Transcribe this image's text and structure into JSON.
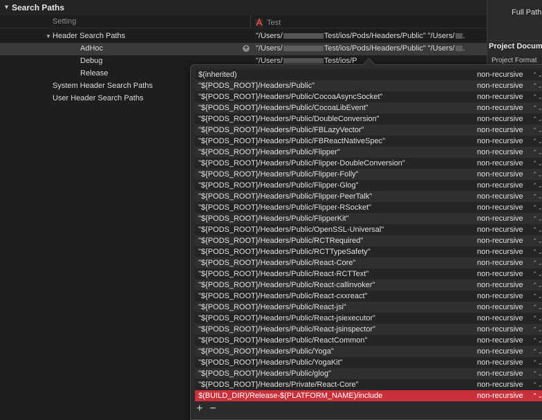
{
  "section": {
    "title": "Search Paths",
    "disclosure": "▼"
  },
  "columns": {
    "setting": "Setting",
    "target": "Test",
    "target_icon": "xcode-app-icon"
  },
  "rows": [
    {
      "label": "Header Search Paths",
      "value_pre": "\"/Users/",
      "value_post": "Test/ios/Pods/Headers/Public\" \"/Users/",
      "value_end": "."
    },
    {
      "label": "AdHoc",
      "value_pre": "\"/Users/",
      "value_post": "Test/ios/Pods/Headers/Public\" \"/Users/",
      "value_end": "."
    },
    {
      "label": "Debug",
      "value_pre": "\"/Users/",
      "value_post": "Test/ios/P",
      "value_end": ""
    },
    {
      "label": "Release"
    },
    {
      "label": "System Header Search Paths"
    },
    {
      "label": "User Header Search Paths"
    }
  ],
  "inspector": {
    "full_path": "Full Path",
    "project_document": "Project Docume",
    "project_format": "Project Format"
  },
  "popover": {
    "items": [
      {
        "path": "$(inherited)",
        "recursion": "non-recursive"
      },
      {
        "path": "\"${PODS_ROOT}/Headers/Public\"",
        "recursion": "non-recursive"
      },
      {
        "path": "\"${PODS_ROOT}/Headers/Public/CocoaAsyncSocket\"",
        "recursion": "non-recursive"
      },
      {
        "path": "\"${PODS_ROOT}/Headers/Public/CocoaLibEvent\"",
        "recursion": "non-recursive"
      },
      {
        "path": "\"${PODS_ROOT}/Headers/Public/DoubleConversion\"",
        "recursion": "non-recursive"
      },
      {
        "path": "\"${PODS_ROOT}/Headers/Public/FBLazyVector\"",
        "recursion": "non-recursive"
      },
      {
        "path": "\"${PODS_ROOT}/Headers/Public/FBReactNativeSpec\"",
        "recursion": "non-recursive"
      },
      {
        "path": "\"${PODS_ROOT}/Headers/Public/Flipper\"",
        "recursion": "non-recursive"
      },
      {
        "path": "\"${PODS_ROOT}/Headers/Public/Flipper-DoubleConversion\"",
        "recursion": "non-recursive"
      },
      {
        "path": "\"${PODS_ROOT}/Headers/Public/Flipper-Folly\"",
        "recursion": "non-recursive"
      },
      {
        "path": "\"${PODS_ROOT}/Headers/Public/Flipper-Glog\"",
        "recursion": "non-recursive"
      },
      {
        "path": "\"${PODS_ROOT}/Headers/Public/Flipper-PeerTalk\"",
        "recursion": "non-recursive"
      },
      {
        "path": "\"${PODS_ROOT}/Headers/Public/Flipper-RSocket\"",
        "recursion": "non-recursive"
      },
      {
        "path": "\"${PODS_ROOT}/Headers/Public/FlipperKit\"",
        "recursion": "non-recursive"
      },
      {
        "path": "\"${PODS_ROOT}/Headers/Public/OpenSSL-Universal\"",
        "recursion": "non-recursive"
      },
      {
        "path": "\"${PODS_ROOT}/Headers/Public/RCTRequired\"",
        "recursion": "non-recursive"
      },
      {
        "path": "\"${PODS_ROOT}/Headers/Public/RCTTypeSafety\"",
        "recursion": "non-recursive"
      },
      {
        "path": "\"${PODS_ROOT}/Headers/Public/React-Core\"",
        "recursion": "non-recursive"
      },
      {
        "path": "\"${PODS_ROOT}/Headers/Public/React-RCTText\"",
        "recursion": "non-recursive"
      },
      {
        "path": "\"${PODS_ROOT}/Headers/Public/React-callinvoker\"",
        "recursion": "non-recursive"
      },
      {
        "path": "\"${PODS_ROOT}/Headers/Public/React-cxxreact\"",
        "recursion": "non-recursive"
      },
      {
        "path": "\"${PODS_ROOT}/Headers/Public/React-jsi\"",
        "recursion": "non-recursive"
      },
      {
        "path": "\"${PODS_ROOT}/Headers/Public/React-jsiexecutor\"",
        "recursion": "non-recursive"
      },
      {
        "path": "\"${PODS_ROOT}/Headers/Public/React-jsinspector\"",
        "recursion": "non-recursive"
      },
      {
        "path": "\"${PODS_ROOT}/Headers/Public/ReactCommon\"",
        "recursion": "non-recursive"
      },
      {
        "path": "\"${PODS_ROOT}/Headers/Public/Yoga\"",
        "recursion": "non-recursive"
      },
      {
        "path": "\"${PODS_ROOT}/Headers/Public/YogaKit\"",
        "recursion": "non-recursive"
      },
      {
        "path": "\"${PODS_ROOT}/Headers/Public/glog\"",
        "recursion": "non-recursive"
      },
      {
        "path": "\"${PODS_ROOT}/Headers/Private/React-Core\"",
        "recursion": "non-recursive"
      },
      {
        "path": "$(BUILD_DIR)/Release-$(PLATFORM_NAME)/include",
        "recursion": "non-recursive",
        "selected": true
      }
    ],
    "add_label": "+",
    "remove_label": "−",
    "stepper_glyph": "⌃⌄"
  },
  "colors": {
    "selection_red": "#c8303a",
    "background": "#1e1e1e",
    "row_selected": "#3a3a3a"
  }
}
